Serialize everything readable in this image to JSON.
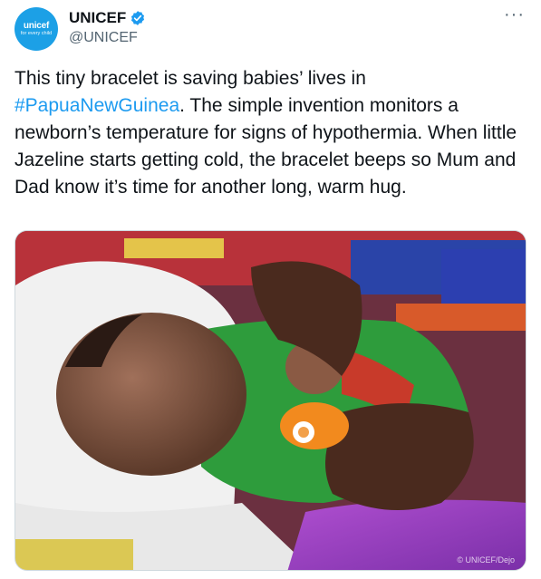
{
  "author": {
    "avatar_brand": "unicef",
    "avatar_tagline": "for every child",
    "display_name": "UNICEF",
    "handle": "@UNICEF",
    "verified_icon": "verified-badge-icon"
  },
  "menu": {
    "more_label": "···"
  },
  "tweet": {
    "text_before": "This tiny bracelet is saving babies’ lives in ",
    "hashtag": "#PapuaNewGuinea",
    "text_after": ". The simple invention monitors a newborn’s temperature for signs of hypothermia. When little Jazeline starts getting cold, the bracelet beeps so Mum and Dad know it’s time for another long, warm hug."
  },
  "media": {
    "photo_credit": "© UNICEF/Dejo"
  },
  "colors": {
    "brand_blue": "#1ca0e6",
    "link_blue": "#1d9bf0",
    "text": "#0f1419",
    "secondary": "#536471"
  }
}
